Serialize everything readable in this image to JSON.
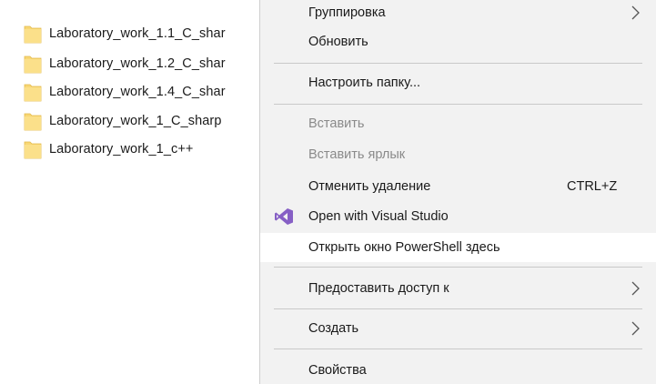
{
  "explorer": {
    "files": [
      {
        "name": "Laboratory_work_1.1_C_shar",
        "icon": "folder-icon"
      },
      {
        "name": "Laboratory_work_1.2_C_shar",
        "icon": "folder-icon"
      },
      {
        "name": "Laboratory_work_1.4_C_shar",
        "icon": "folder-icon"
      },
      {
        "name": "Laboratory_work_1_C_sharp",
        "icon": "folder-icon"
      },
      {
        "name": "Laboratory_work_1_c++",
        "icon": "folder-icon"
      }
    ]
  },
  "context_menu": {
    "items": [
      {
        "label": "Группировка",
        "submenu": true,
        "disabled": false
      },
      {
        "label": "Обновить",
        "disabled": false
      },
      {
        "label": "Настроить папку...",
        "disabled": false
      },
      {
        "label": "Вставить",
        "disabled": true
      },
      {
        "label": "Вставить ярлык",
        "disabled": true
      },
      {
        "label": "Отменить удаление",
        "shortcut": "CTRL+Z",
        "disabled": false
      },
      {
        "label": "Open with Visual Studio",
        "icon": "visual-studio-icon",
        "disabled": false
      },
      {
        "label": "Открыть окно PowerShell здесь",
        "disabled": false,
        "hovered": true
      },
      {
        "label": "Предоставить доступ к",
        "submenu": true,
        "disabled": false
      },
      {
        "label": "Создать",
        "submenu": true,
        "disabled": false
      },
      {
        "label": "Свойства",
        "disabled": false
      }
    ]
  },
  "colors": {
    "menu_background": "#f2f2f2",
    "hover_background": "#ffffff",
    "disabled_text": "#8a8a8a",
    "folder_yellow": "#f8d775",
    "visual_studio_purple": "#865fc5"
  }
}
